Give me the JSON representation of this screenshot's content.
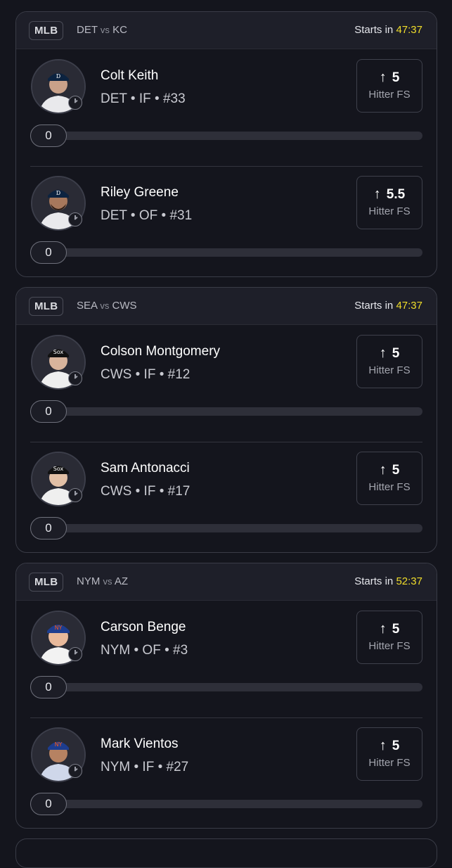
{
  "games": [
    {
      "league": "MLB",
      "home": "DET",
      "vs": "vs",
      "away": "KC",
      "starts_label": "Starts in",
      "starts_time": "47:37",
      "players": [
        {
          "name": "Colt Keith",
          "meta": "DET • IF • #33",
          "projection": "5",
          "stat": "Hitter FS",
          "progress_value": "0",
          "progress_fraction": 0
        },
        {
          "name": "Riley Greene",
          "meta": "DET • OF • #31",
          "projection": "5.5",
          "stat": "Hitter FS",
          "progress_value": "0",
          "progress_fraction": 0
        }
      ]
    },
    {
      "league": "MLB",
      "home": "SEA",
      "vs": "vs",
      "away": "CWS",
      "starts_label": "Starts in",
      "starts_time": "47:37",
      "players": [
        {
          "name": "Colson Montgomery",
          "meta": "CWS • IF • #12",
          "projection": "5",
          "stat": "Hitter FS",
          "progress_value": "0",
          "progress_fraction": 0
        },
        {
          "name": "Sam Antonacci",
          "meta": "CWS • IF • #17",
          "projection": "5",
          "stat": "Hitter FS",
          "progress_value": "0",
          "progress_fraction": 0
        }
      ]
    },
    {
      "league": "MLB",
      "home": "NYM",
      "vs": "vs",
      "away": "AZ",
      "starts_label": "Starts in",
      "starts_time": "52:37",
      "players": [
        {
          "name": "Carson Benge",
          "meta": "NYM • OF • #3",
          "projection": "5",
          "stat": "Hitter FS",
          "progress_value": "0",
          "progress_fraction": 0
        },
        {
          "name": "Mark Vientos",
          "meta": "NYM • IF • #27",
          "projection": "5",
          "stat": "Hitter FS",
          "progress_value": "0",
          "progress_fraction": 0
        }
      ]
    }
  ],
  "icons": {
    "arrow": "arrow-up-icon",
    "clock": "clock-icon",
    "avatar": "player-headshot"
  },
  "colors": {
    "background": "#14151d",
    "header": "#1e1f29",
    "timer": "#f0dd2a",
    "border": "#3a3c47"
  }
}
